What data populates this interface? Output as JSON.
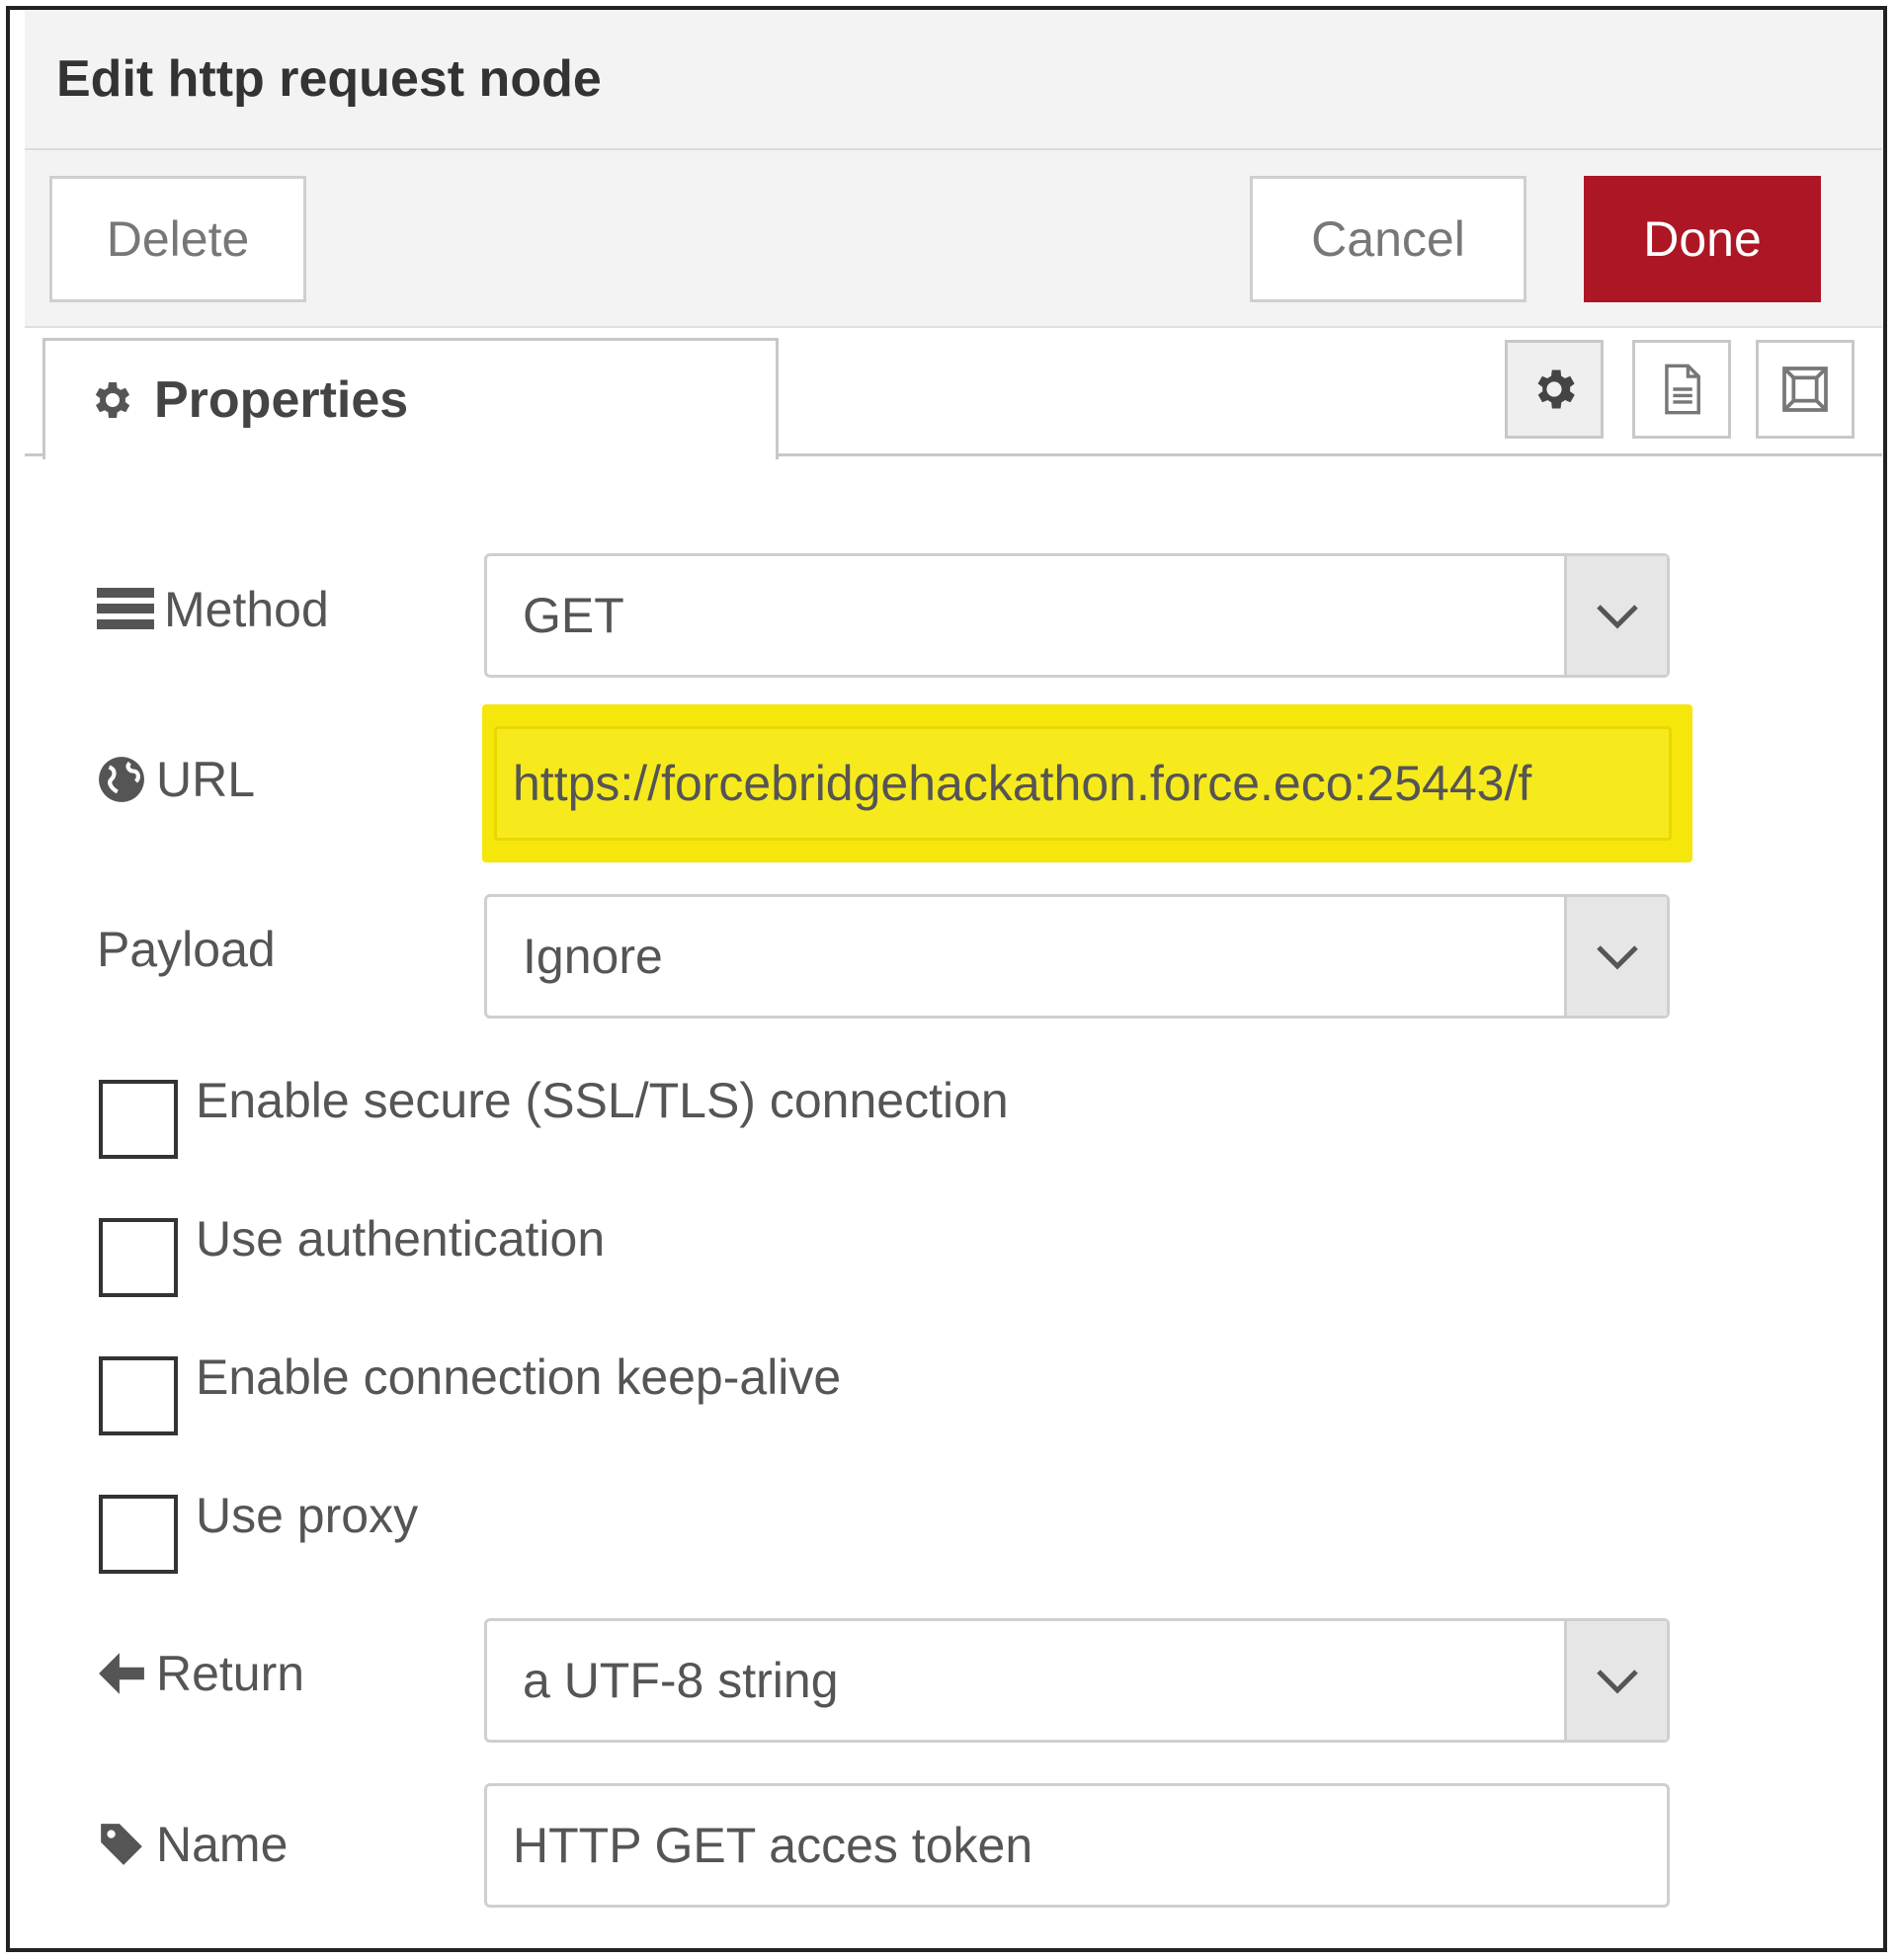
{
  "dialog": {
    "title": "Edit http request node"
  },
  "toolbar": {
    "delete_label": "Delete",
    "cancel_label": "Cancel",
    "done_label": "Done"
  },
  "tabs": {
    "active_label": "Properties"
  },
  "form": {
    "method": {
      "label": "Method",
      "value": "GET"
    },
    "url": {
      "label": "URL",
      "value": "https://forcebridgehackathon.force.eco:25443/f"
    },
    "payload": {
      "label": "Payload",
      "value": "Ignore"
    },
    "options": [
      {
        "label": "Enable secure (SSL/TLS) connection",
        "checked": false
      },
      {
        "label": "Use authentication",
        "checked": false
      },
      {
        "label": "Enable connection keep-alive",
        "checked": false
      },
      {
        "label": "Use proxy",
        "checked": false
      }
    ],
    "return": {
      "label": "Return",
      "value": "a UTF-8 string"
    },
    "name": {
      "label": "Name",
      "value": "HTTP GET acces token"
    }
  },
  "colors": {
    "done_button": "#ad1625",
    "url_highlight": "#f5e60c"
  },
  "icons": [
    "gear-icon",
    "document-icon",
    "frame-icon",
    "list-icon",
    "globe-icon",
    "arrow-left-icon",
    "tag-icon",
    "chevron-down-icon"
  ]
}
